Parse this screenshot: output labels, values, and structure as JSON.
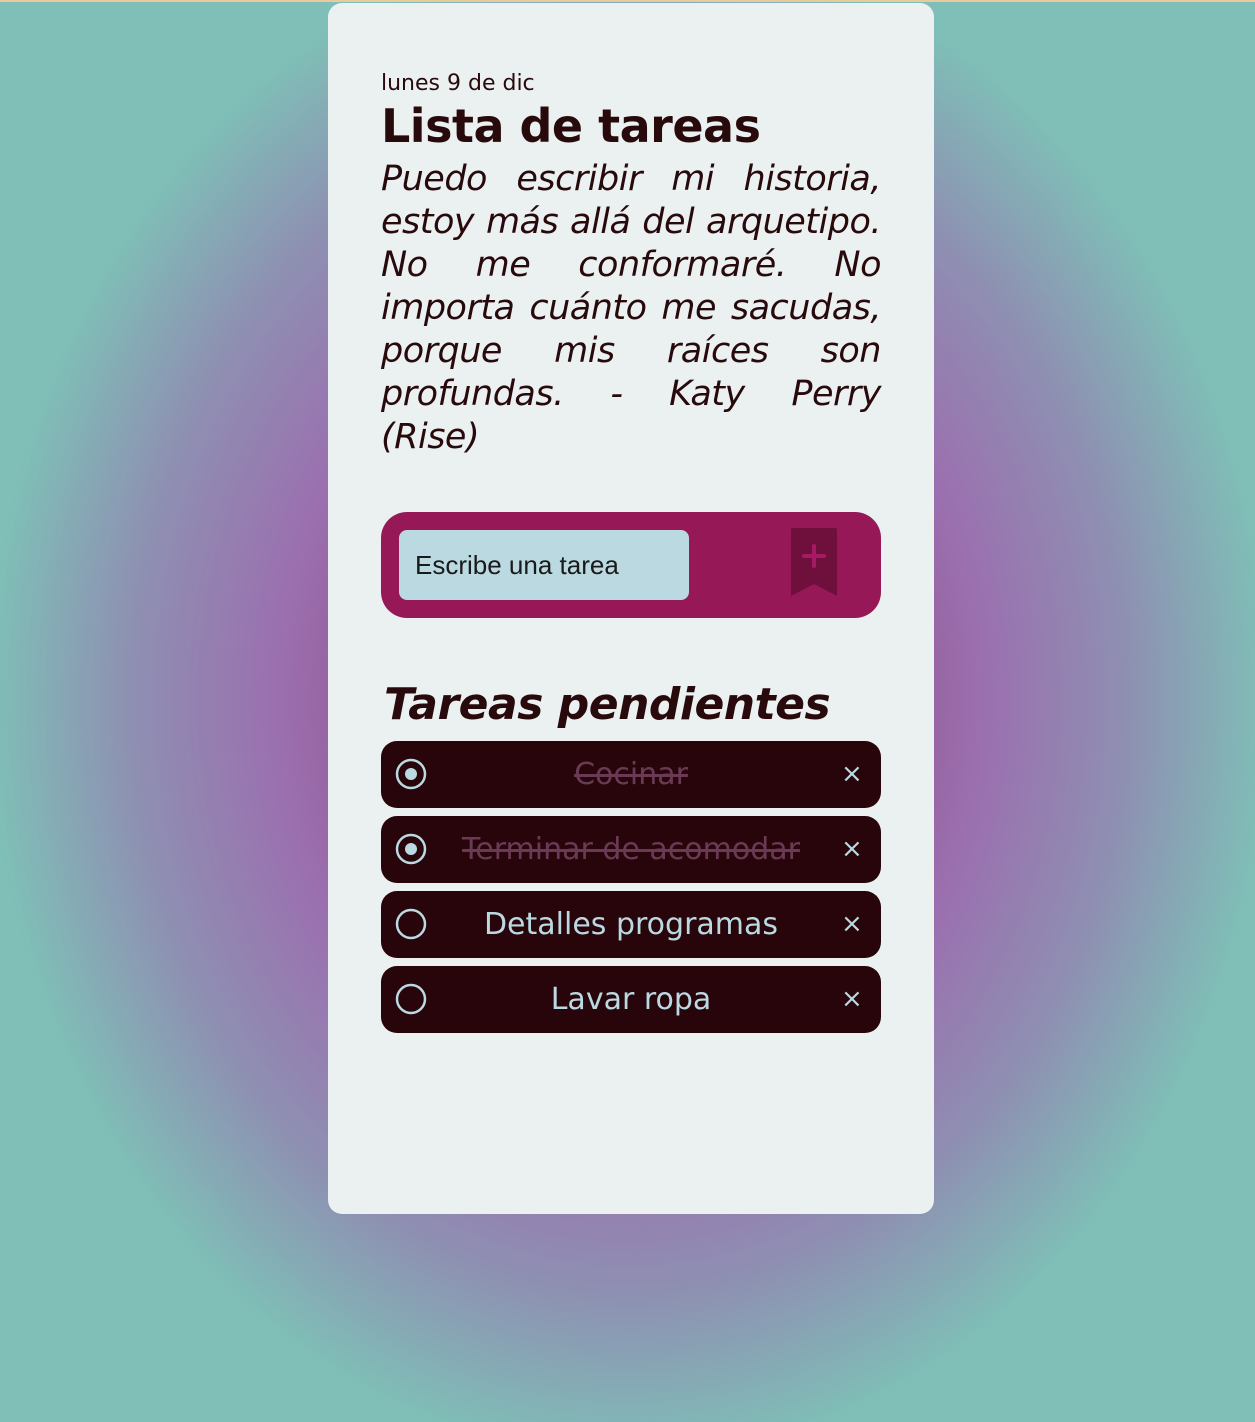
{
  "header": {
    "date": "lunes 9 de dic",
    "title": "Lista de tareas",
    "quote": "Puedo escribir mi historia, estoy más allá del arquetipo. No me conformaré. No importa cuánto me sacudas, porque mis raíces son profundas. - Katy Perry (Rise)"
  },
  "form": {
    "input_placeholder": "Escribe una tarea",
    "input_value": "",
    "add_icon": "bookmark-plus-icon"
  },
  "list": {
    "heading": "Tareas pendientes",
    "tasks": [
      {
        "text": "Cocinar",
        "completed": true
      },
      {
        "text": "Terminar de acomodar",
        "completed": true
      },
      {
        "text": "Detalles programas",
        "completed": false
      },
      {
        "text": "Lavar ropa",
        "completed": false
      }
    ],
    "delete_symbol": "×"
  },
  "colors": {
    "card_bg": "#ebf1f0",
    "text_dark": "#280a0d",
    "accent": "#971856",
    "input_bg": "#bbd9e1",
    "task_bg": "#27050b",
    "done_text": "#6a3a54"
  }
}
